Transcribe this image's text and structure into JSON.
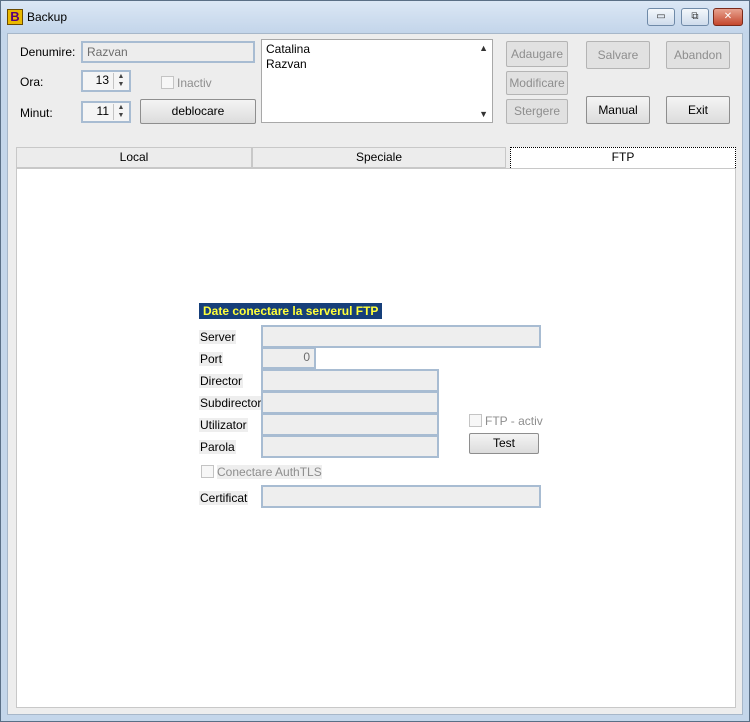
{
  "window": {
    "title": "Backup",
    "app_icon_letter": "B",
    "buttons": {
      "minimize": "▭",
      "maximize": "⧉",
      "close": "✕"
    }
  },
  "form": {
    "denumire_label": "Denumire:",
    "denumire_value": "Razvan",
    "ora_label": "Ora:",
    "ora_value": "13",
    "minut_label": "Minut:",
    "minut_value": "11",
    "inactiv_label": "Inactiv",
    "deblocare_label": "deblocare",
    "list_items": [
      "Catalina",
      "Razvan"
    ]
  },
  "actions": {
    "adaugare": "Adaugare",
    "modificare": "Modificare",
    "stergere": "Stergere",
    "salvare": "Salvare",
    "abandon": "Abandon",
    "manual": "Manual",
    "exit": "Exit"
  },
  "tabs": [
    {
      "label": "Local"
    },
    {
      "label": "Speciale"
    },
    {
      "label": "FTP"
    }
  ],
  "ftp": {
    "section_title": "Date conectare la serverul FTP",
    "server_label": "Server",
    "server_value": "",
    "port_label": "Port",
    "port_value": "0",
    "director_label": "Director",
    "subdirector_label": "Subdirector",
    "utilizator_label": "Utilizator",
    "parola_label": "Parola",
    "ftp_activ_label": "FTP - activ",
    "test_label": "Test",
    "authtls_label": "Conectare AuthTLS",
    "certificat_label": "Certificat"
  },
  "colors": {
    "section_title_bg": "#163f7a",
    "section_title_fg": "#ffff3a",
    "window_frame": "#c4d6ea"
  }
}
